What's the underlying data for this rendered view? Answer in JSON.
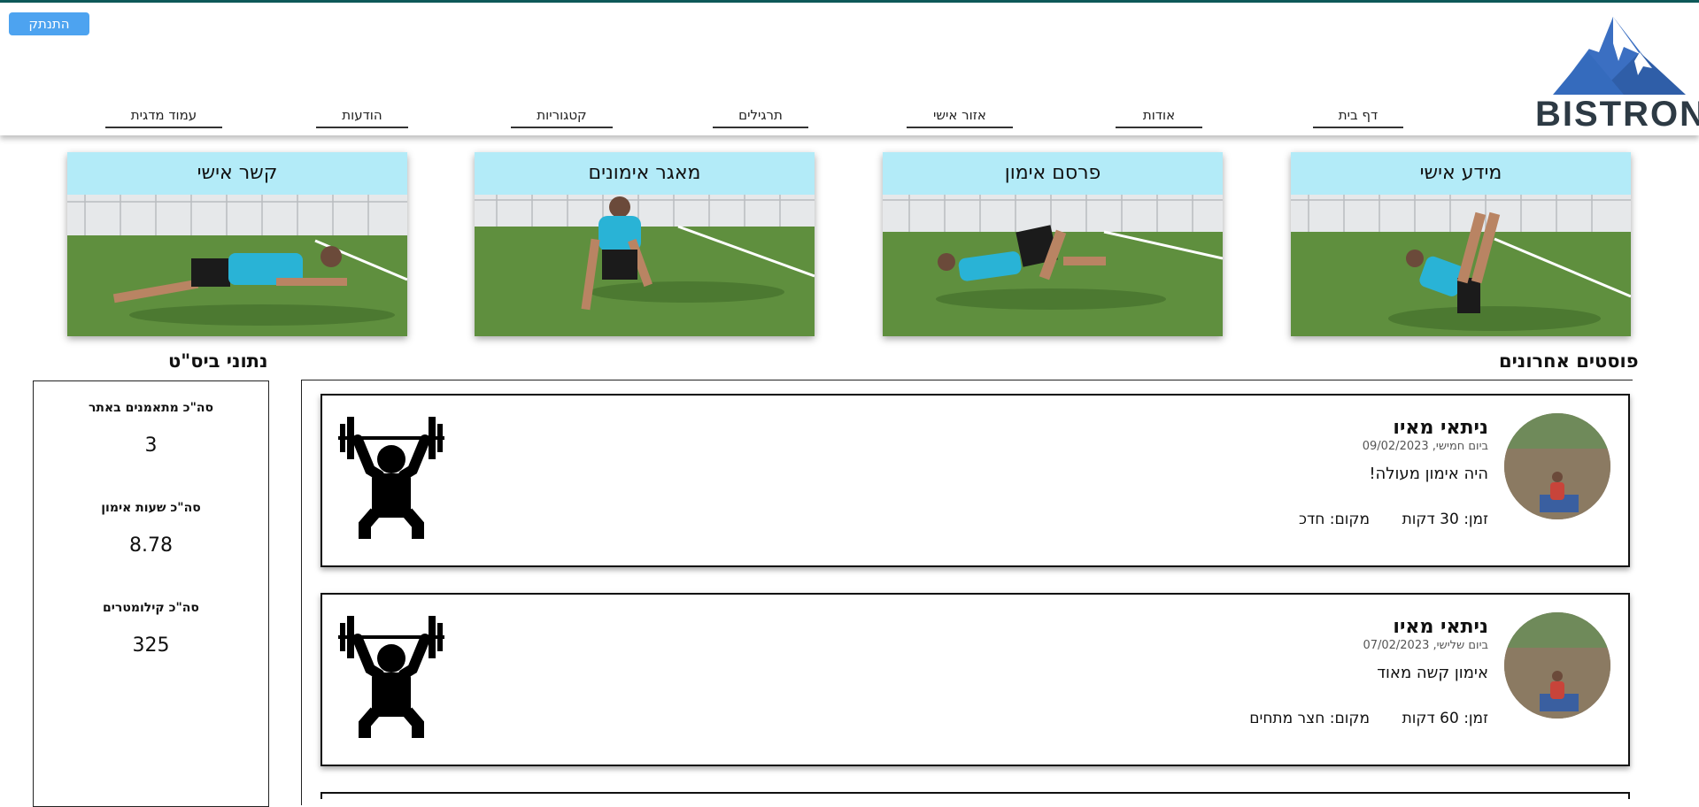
{
  "header": {
    "logout_label": "התנתק",
    "logo_text": "BISTRONG",
    "nav": [
      {
        "label": "דף בית"
      },
      {
        "label": "אודות"
      },
      {
        "label": "אזור אישי"
      },
      {
        "label": "תרגילים"
      },
      {
        "label": "קטגוריות"
      },
      {
        "label": "הודעות"
      },
      {
        "label": "עמוד מדגית"
      }
    ]
  },
  "cards": [
    {
      "label": "מידע אישי"
    },
    {
      "label": "פרסם אימון"
    },
    {
      "label": "מאגר אימונים"
    },
    {
      "label": "קשר אישי"
    }
  ],
  "stats": {
    "title": "נתוני ביס\"ט",
    "items": [
      {
        "label": "סה\"כ מתאמנים באתר",
        "value": "3"
      },
      {
        "label": "סה\"כ שעות אימון",
        "value": "8.78"
      },
      {
        "label": "סה\"כ קילומטרים",
        "value": "325"
      }
    ]
  },
  "posts": {
    "title": "פוסטים אחרונים",
    "items": [
      {
        "author": "ניתאי מאיו",
        "date": "ביום חמישי, 09/02/2023",
        "text": "היה אימון מעולה!",
        "time": "זמן: 30 דקות",
        "place": "מקום: חדכ"
      },
      {
        "author": "ניתאי מאיו",
        "date": "ביום שלישי, 07/02/2023",
        "text": "אימון קשה מאוד",
        "time": "זמן: 60 דקות",
        "place": "מקום: חצר מתחים"
      }
    ]
  },
  "colors": {
    "accent": "#4da3f0",
    "card_header": "#b3ebf8",
    "logo_blue": "#3b6fc2",
    "top_line": "#0f5a5a"
  }
}
